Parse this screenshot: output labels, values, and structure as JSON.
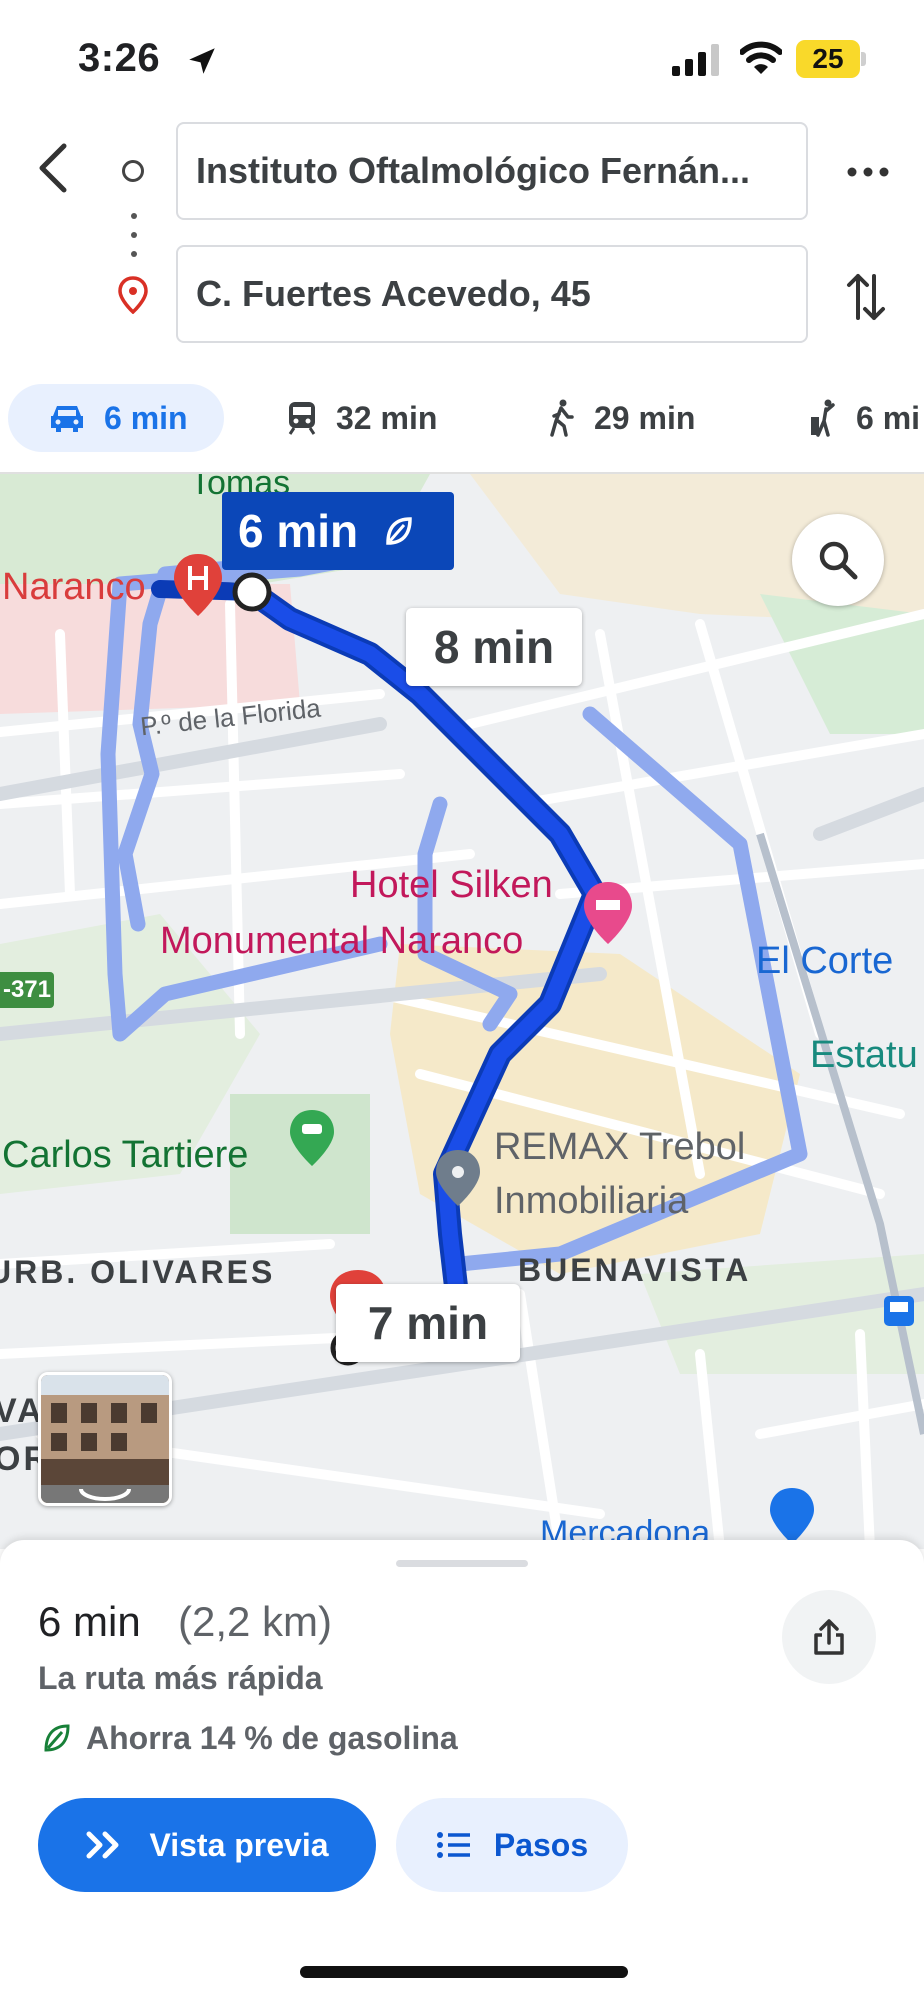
{
  "status_bar": {
    "time": "3:26",
    "battery": "25"
  },
  "directions": {
    "origin": "Instituto Oftalmológico Fernán...",
    "destination": "C. Fuertes Acevedo, 45"
  },
  "modes": [
    {
      "name": "car",
      "label": "6 min",
      "active": true
    },
    {
      "name": "transit",
      "label": "32 min"
    },
    {
      "name": "walk",
      "label": "29 min"
    },
    {
      "name": "ride",
      "label": "6 mi"
    }
  ],
  "map": {
    "selected_route_time": "6 min",
    "alt_route_1_time": "8 min",
    "alt_route_2_time": "7 min",
    "labels": {
      "tomas": "Tomás",
      "naranco": "Naranco",
      "street": "P.º de la Florida",
      "hotel_line1": "Hotel Silken",
      "hotel_line2": "Monumental Naranco",
      "el_corte": "El Corte",
      "estatu": "Estatu",
      "tartiere": "Carlos Tartiere",
      "remax_line1": "REMAX Trebol",
      "remax_line2": "Inmobiliaria",
      "olivares": "URB. OLIVARES",
      "buenavista": "BUENAVISTA",
      "mercadona": "Mercadona",
      "road_shield": "-371",
      "edge_v": "VA",
      "edge_r": "OR"
    },
    "route_color_selected": "#1a4de8",
    "route_color_alt": "#8fa9ee"
  },
  "sheet": {
    "duration": "6 min",
    "distance": "(2,2 km)",
    "route_desc": "La ruta más rápida",
    "fuel_saving": "Ahorra 14 % de gasolina",
    "preview_label": "Vista previa",
    "steps_label": "Pasos"
  }
}
